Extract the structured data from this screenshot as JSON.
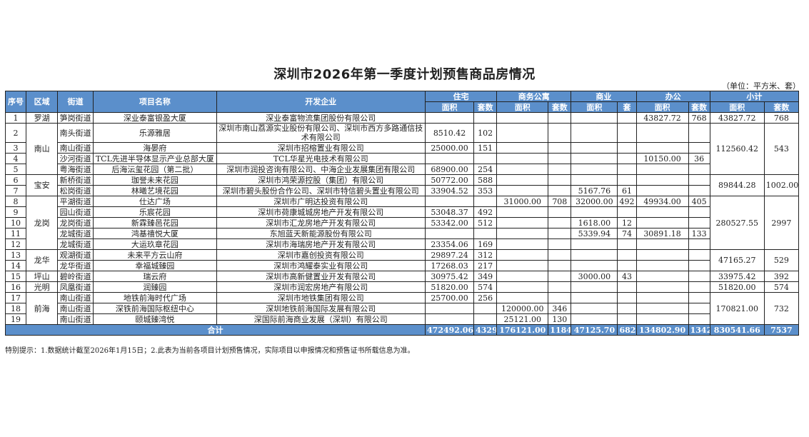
{
  "title": "深圳市2026年第一季度计划预售商品房情况",
  "unit": "（单位：平方米、套）",
  "headers": {
    "seq": "序号",
    "district": "区域",
    "street": "街道",
    "project": "项目名称",
    "developer": "开发企业",
    "groups": [
      "住宅",
      "商务公寓",
      "商业",
      "办公",
      "小计"
    ],
    "sub": [
      "面积",
      "套数",
      "面积",
      "套数",
      "面积",
      "套",
      "面积",
      "套数",
      "面积",
      "套数"
    ]
  },
  "districts": [
    {
      "name": "罗湖",
      "subtotal_area": "43827.72",
      "subtotal_units": "768",
      "rows": [
        {
          "seq": "1",
          "street": "笋岗街道",
          "project": "深业泰富银盈大厦",
          "developer": "深业泰富物流集团股份有限公司",
          "v": [
            "",
            "",
            "",
            "",
            "",
            "",
            "43827.72",
            "768"
          ]
        }
      ]
    },
    {
      "name": "南山",
      "subtotal_area": "112560.42",
      "subtotal_units": "543",
      "rows": [
        {
          "seq": "2",
          "street": "南头街道",
          "project": "乐源雅居",
          "developer": "深圳市南山荔源实业股份有限公司、深圳市西方多路通信技术有限公司",
          "v": [
            "8510.42",
            "102",
            "",
            "",
            "",
            "",
            "",
            ""
          ]
        },
        {
          "seq": "3",
          "street": "南山街道",
          "project": "海晏府",
          "developer": "深圳市招榕置业有限公司",
          "v": [
            "25000.00",
            "151",
            "",
            "",
            "",
            "",
            "",
            ""
          ]
        },
        {
          "seq": "4",
          "street": "沙河街道",
          "project": "TCL先进半导体显示产业总部大厦",
          "developer": "TCL华星光电技术有限公司",
          "v": [
            "",
            "",
            "",
            "",
            "",
            "",
            "10150.00",
            "36"
          ]
        },
        {
          "seq": "5",
          "street": "粤海街道",
          "project": "后海沄玺花园（第二批）",
          "developer": "深圳市润投咨询有限公司、中海企业发展集团有限公司",
          "v": [
            "68900.00",
            "254",
            "",
            "",
            "",
            "",
            "",
            ""
          ]
        }
      ]
    },
    {
      "name": "宝安",
      "subtotal_area": "89844.28",
      "subtotal_units": "1002.00",
      "rows": [
        {
          "seq": "6",
          "street": "新桥街道",
          "project": "珈誉未来花园",
          "developer": "深圳市鸿荣源控股（集团）有限公司",
          "v": [
            "50772.00",
            "588",
            "",
            "",
            "",
            "",
            "",
            ""
          ]
        },
        {
          "seq": "7",
          "street": "松岗街道",
          "project": "林曦艺境花园",
          "developer": "深圳市碧头股份合作公司、深圳市特信碧头置业有限公司",
          "v": [
            "33904.52",
            "353",
            "",
            "",
            "5167.76",
            "61",
            "",
            ""
          ]
        }
      ]
    },
    {
      "name": "龙岗",
      "subtotal_area": "280527.55",
      "subtotal_units": "2997",
      "rows": [
        {
          "seq": "8",
          "street": "平湖街道",
          "project": "仕达广场",
          "developer": "深圳市广明达投资有限公司",
          "v": [
            "",
            "",
            "31000.00",
            "708",
            "32000.00",
            "492",
            "49934.00",
            "405"
          ]
        },
        {
          "seq": "9",
          "street": "园山街道",
          "project": "乐宸花园",
          "developer": "深圳市荷康城城房地产开发有限公司",
          "v": [
            "53048.37",
            "492",
            "",
            "",
            "",
            "",
            "",
            ""
          ]
        },
        {
          "seq": "10",
          "street": "龙岗街道",
          "project": "新霖臻邑花园",
          "developer": "深圳市汇龙房地产开发有限公司",
          "v": [
            "53342.00",
            "512",
            "",
            "",
            "1618.00",
            "12",
            "",
            ""
          ]
        },
        {
          "seq": "11",
          "street": "龙城街道",
          "project": "鸿基禧悦大厦",
          "developer": "东旭蓝天新能源股份有限公司",
          "v": [
            "",
            "",
            "",
            "",
            "5339.94",
            "74",
            "30891.18",
            "133"
          ]
        },
        {
          "seq": "12",
          "street": "龙城街道",
          "project": "大运玖章花园",
          "developer": "深圳市海瑞房地产开发有限公司",
          "v": [
            "23354.06",
            "169",
            "",
            "",
            "",
            "",
            "",
            ""
          ]
        }
      ]
    },
    {
      "name": "龙华",
      "subtotal_area": "47165.27",
      "subtotal_units": "529",
      "rows": [
        {
          "seq": "13",
          "street": "观湖街道",
          "project": "未来平方云山府",
          "developer": "深圳市嘉创投资有限公司",
          "v": [
            "29897.24",
            "312",
            "",
            "",
            "",
            "",
            "",
            ""
          ]
        },
        {
          "seq": "14",
          "street": "龙华街道",
          "project": "幸福城臻园",
          "developer": "深圳市鸿耀泰实业有限公司",
          "v": [
            "17268.03",
            "217",
            "",
            "",
            "",
            "",
            "",
            ""
          ]
        }
      ]
    },
    {
      "name": "坪山",
      "subtotal_area": "33975.42",
      "subtotal_units": "392",
      "rows": [
        {
          "seq": "15",
          "street": "碧岭街道",
          "project": "瑞云府",
          "developer": "深圳市高新健置业开发有限公司",
          "v": [
            "30975.42",
            "349",
            "",
            "",
            "3000.00",
            "43",
            "",
            ""
          ]
        }
      ]
    },
    {
      "name": "光明",
      "subtotal_area": "51820.00",
      "subtotal_units": "574",
      "rows": [
        {
          "seq": "16",
          "street": "凤凰街道",
          "project": "润臻园",
          "developer": "深圳市润宏房地产有限公司",
          "v": [
            "51820.00",
            "574",
            "",
            "",
            "",
            "",
            "",
            ""
          ]
        }
      ]
    },
    {
      "name": "前海",
      "subtotal_area": "170821.00",
      "subtotal_units": "732",
      "rows": [
        {
          "seq": "17",
          "street": "南山街道",
          "project": "地铁前海时代广场",
          "developer": "深圳市地铁集团有限公司",
          "v": [
            "25700.00",
            "256",
            "",
            "",
            "",
            "",
            "",
            ""
          ]
        },
        {
          "seq": "18",
          "street": "南山街道",
          "project": "深铁前海国际枢纽中心",
          "developer": "深圳地铁前海国际发展有限公司",
          "v": [
            "",
            "",
            "120000.00",
            "346",
            "",
            "",
            "",
            ""
          ]
        },
        {
          "seq": "19",
          "street": "南山街道",
          "project": "颐城臻湾悦",
          "developer": "深国际前海商业发展（深圳）有限公司",
          "v": [
            "",
            "",
            "25121.00",
            "130",
            "",
            "",
            "",
            ""
          ]
        }
      ]
    }
  ],
  "total": {
    "label": "合计",
    "v": [
      "472492.06",
      "4329",
      "176121.00",
      "1184",
      "47125.70",
      "682",
      "134802.90",
      "1342",
      "830541.66",
      "7537"
    ]
  },
  "note": "特别提示：1.数据统计截至2026年1月15日；2.此表为当前各项目计划预售情况，实际项目以申报情况和预售证书所载信息为准。"
}
